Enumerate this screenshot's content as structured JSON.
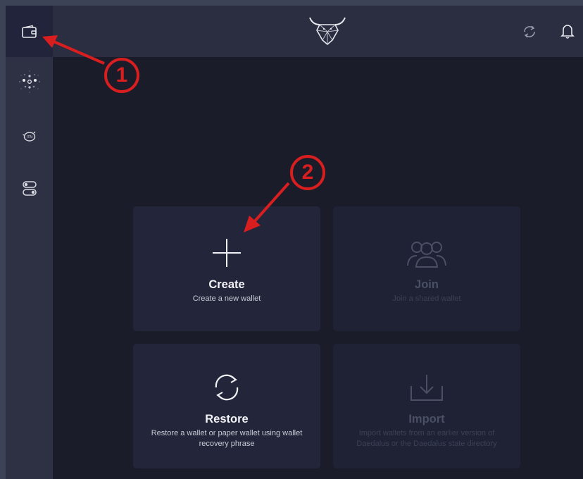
{
  "sidebar": {
    "items": [
      {
        "icon": "wallet-icon",
        "active": true
      },
      {
        "icon": "staking-icon",
        "active": false
      },
      {
        "icon": "piggy-bank-icon",
        "active": false
      },
      {
        "icon": "settings-toggle-icon",
        "active": false
      }
    ]
  },
  "topbar": {
    "logo": "bull-logo",
    "sync_icon": "sync-icon",
    "notification_icon": "bell-icon"
  },
  "cards": {
    "create": {
      "title": "Create",
      "description": "Create a new wallet",
      "icon": "plus-icon",
      "enabled": true
    },
    "join": {
      "title": "Join",
      "description": "Join a shared wallet",
      "icon": "users-icon",
      "enabled": false
    },
    "restore": {
      "title": "Restore",
      "description": "Restore a wallet or paper wallet using wallet recovery phrase",
      "icon": "refresh-icon",
      "enabled": true
    },
    "import": {
      "title": "Import",
      "description": "Import wallets from an earlier version of Daedalus or the Daedalus state directory",
      "icon": "download-icon",
      "enabled": false
    }
  },
  "annotations": [
    {
      "label": "1"
    },
    {
      "label": "2"
    }
  ],
  "colors": {
    "annotation": "#d81e1e",
    "background": "#1a1c2a",
    "card": "#23263a",
    "sidebar": "#2d3143"
  }
}
